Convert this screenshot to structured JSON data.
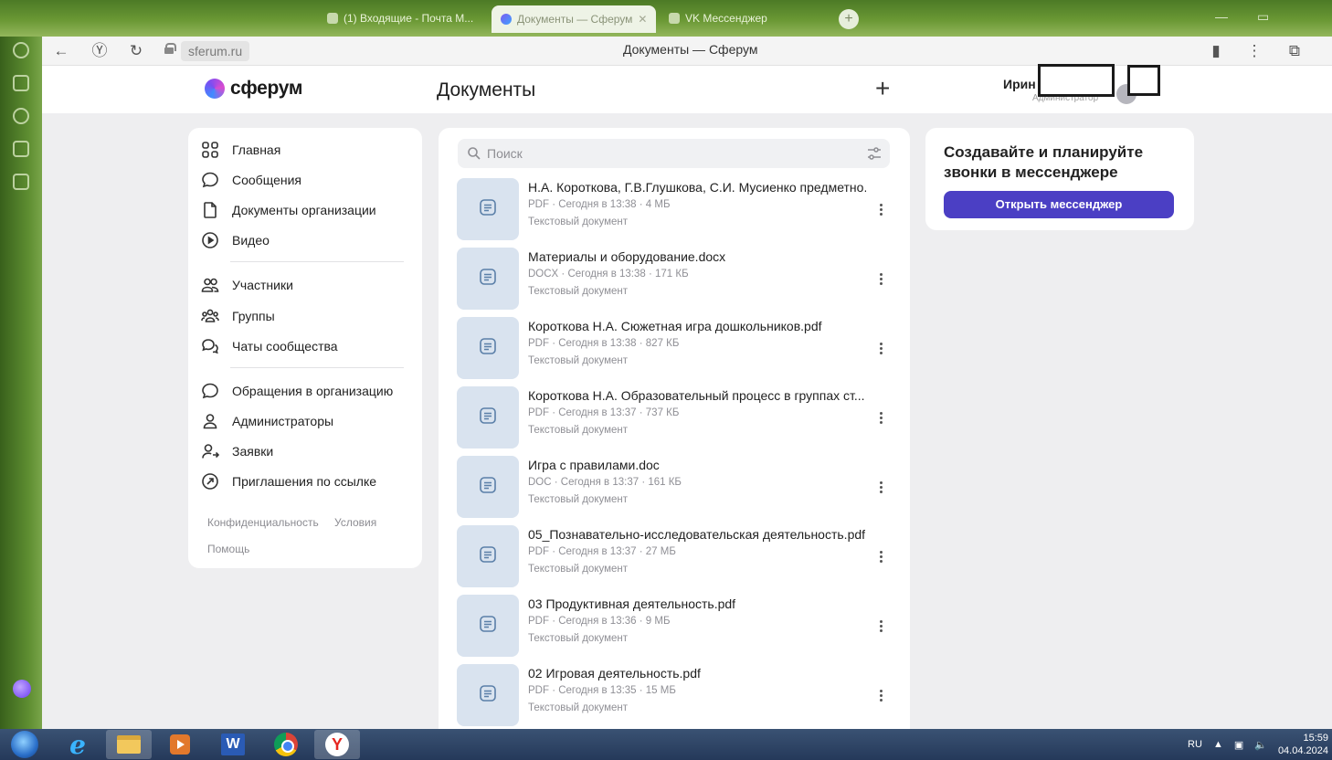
{
  "browser": {
    "tabs": [
      {
        "label": "(1) Входящие - Почта М..."
      },
      {
        "label": "Документы — Сферум"
      },
      {
        "label": "VK Мессенджер"
      }
    ],
    "url": "sferum.ru",
    "page_title": "Документы — Сферум"
  },
  "site": {
    "logo_text": "сферум",
    "heading": "Документы",
    "add_label": "+",
    "user_name": "Ирин",
    "user_role": "Администратор"
  },
  "nav": {
    "items": [
      {
        "label": "Главная",
        "icon": "grid-icon"
      },
      {
        "label": "Сообщения",
        "icon": "chat-bubble-icon"
      },
      {
        "label": "Документы организации",
        "icon": "document-icon"
      },
      {
        "label": "Видео",
        "icon": "play-circle-icon"
      },
      {
        "label": "Участники",
        "icon": "users-icon"
      },
      {
        "label": "Группы",
        "icon": "group-icon"
      },
      {
        "label": "Чаты сообщества",
        "icon": "chats-icon"
      },
      {
        "label": "Обращения в организацию",
        "icon": "chat-bubble-icon"
      },
      {
        "label": "Администраторы",
        "icon": "user-icon"
      },
      {
        "label": "Заявки",
        "icon": "user-request-icon"
      },
      {
        "label": "Приглашения по ссылке",
        "icon": "link-invite-icon"
      }
    ],
    "footer": {
      "privacy": "Конфиденциальность",
      "terms": "Условия",
      "help": "Помощь"
    }
  },
  "search": {
    "placeholder": "Поиск"
  },
  "documents": [
    {
      "name": "Н.А. Короткова, Г.В.Глушкова, С.И. Мусиенко предметно...",
      "meta": "PDF · Сегодня в 13:38 · 4 МБ",
      "type": "Текстовый документ"
    },
    {
      "name": "Материалы и оборудование.docx",
      "meta": "DOCX · Сегодня в 13:38 · 171 КБ",
      "type": "Текстовый документ"
    },
    {
      "name": "Короткова Н.А. Сюжетная игра дошкольников.pdf",
      "meta": "PDF · Сегодня в 13:38 · 827 КБ",
      "type": "Текстовый документ"
    },
    {
      "name": "Короткова Н.А. Образовательный процесс в группах ст...",
      "meta": "PDF · Сегодня в 13:37 · 737 КБ",
      "type": "Текстовый документ"
    },
    {
      "name": "Игра с правилами.doc",
      "meta": "DOC · Сегодня в 13:37 · 161 КБ",
      "type": "Текстовый документ"
    },
    {
      "name": "05_Познавательно-исследовательская деятельность.pdf",
      "meta": "PDF · Сегодня в 13:37 · 27 МБ",
      "type": "Текстовый документ"
    },
    {
      "name": "03 Продуктивная деятельность.pdf",
      "meta": "PDF · Сегодня в 13:36 · 9 МБ",
      "type": "Текстовый документ"
    },
    {
      "name": "02 Игровая деятельность.pdf",
      "meta": "PDF · Сегодня в 13:35 · 15 МБ",
      "type": "Текстовый документ"
    }
  ],
  "promo": {
    "text": "Создавайте и планируйте звонки в мессенджере",
    "button": "Открыть мессенджер"
  },
  "taskbar": {
    "lang": "RU",
    "time": "15:59",
    "date": "04.04.2024"
  },
  "colors": {
    "accent": "#4b3fc4",
    "doc_thumb": "#d9e3ef",
    "page_bg": "#eeeef0"
  }
}
